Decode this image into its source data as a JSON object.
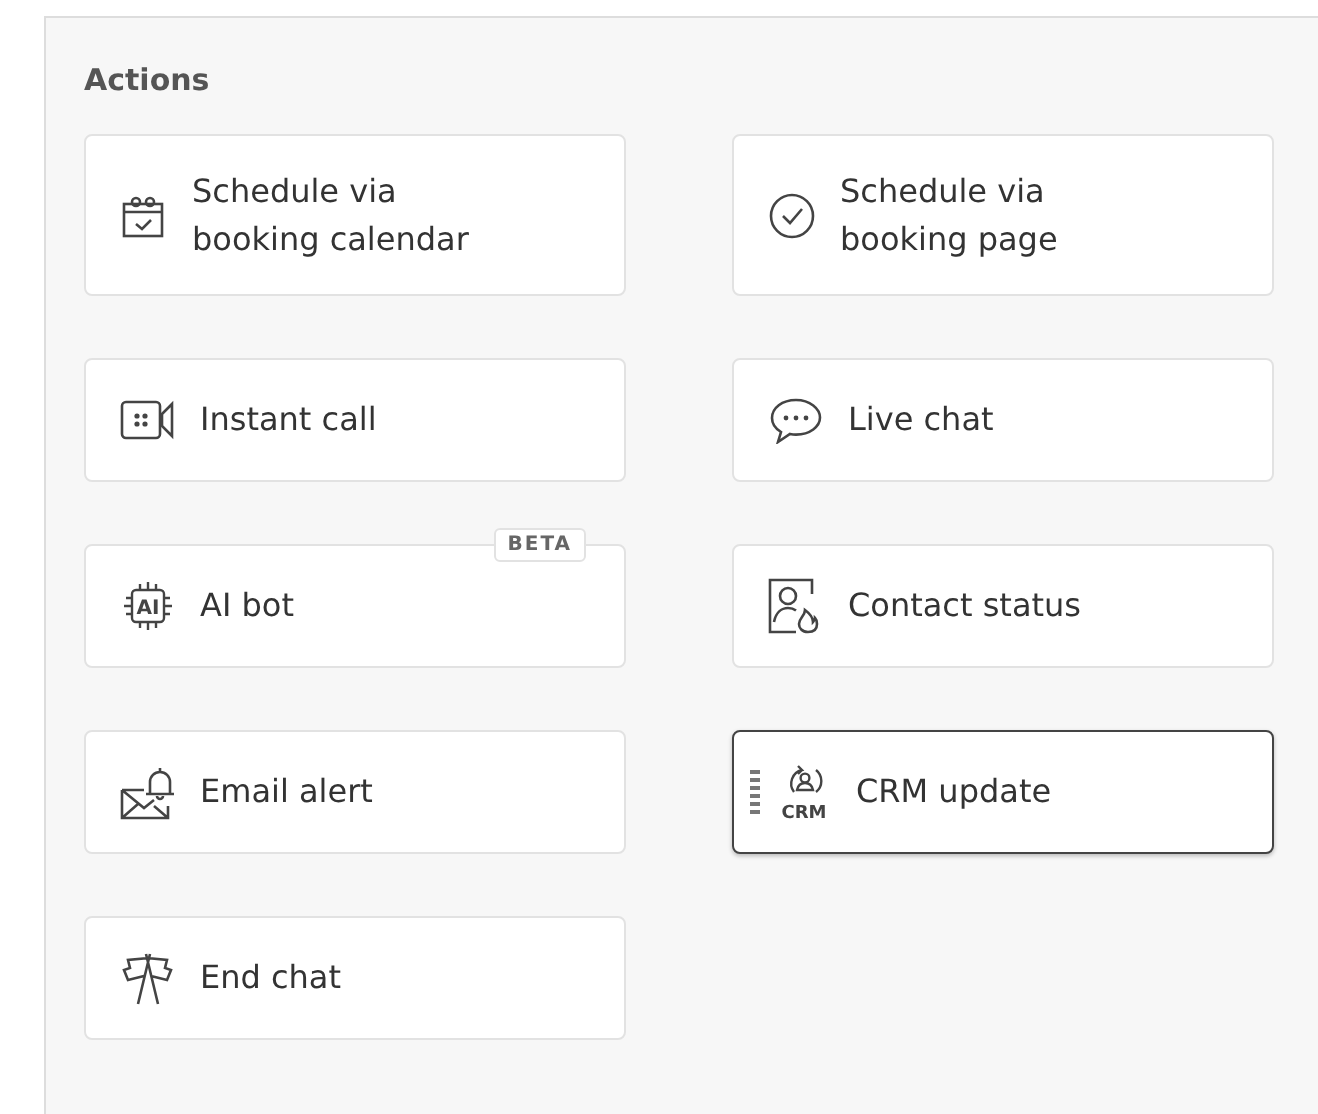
{
  "section": {
    "title": "Actions"
  },
  "actions": [
    {
      "label": "Schedule via booking calendar",
      "selected": false
    },
    {
      "label": "Schedule via booking page",
      "selected": false
    },
    {
      "label": "Instant call",
      "selected": false
    },
    {
      "label": "Live chat",
      "selected": false
    },
    {
      "label": "AI bot",
      "selected": false,
      "icon_text": "AI",
      "badge": "BETA"
    },
    {
      "label": "Contact status",
      "selected": false
    },
    {
      "label": "Email alert",
      "selected": false
    },
    {
      "label": "CRM update",
      "selected": true,
      "icon_text": "CRM"
    },
    {
      "label": "End chat",
      "selected": false
    }
  ]
}
